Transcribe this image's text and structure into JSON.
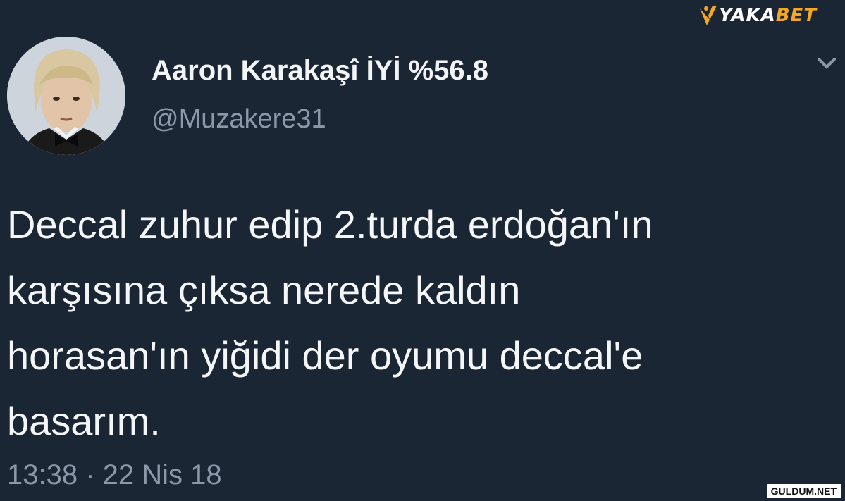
{
  "user": {
    "display_name": "Aaron Karakaşî İYİ %56.8",
    "handle": "@Muzakere31"
  },
  "tweet": {
    "lines": [
      "Deccal zuhur edip 2.turda erdoğan'ın",
      "karşısına çıksa nerede kaldın",
      "horasan'ın yiğidi der oyumu deccal'e",
      "basarım."
    ],
    "timestamp": "13:38 · 22 Nis 18"
  },
  "branding": {
    "logo_text_a": "YAKA",
    "logo_text_b": "BET",
    "watermark": "GULDUM.NET"
  },
  "colors": {
    "background": "#1b2635",
    "secondary_text": "#8a98a8",
    "logo_accent": "#f5a623"
  }
}
